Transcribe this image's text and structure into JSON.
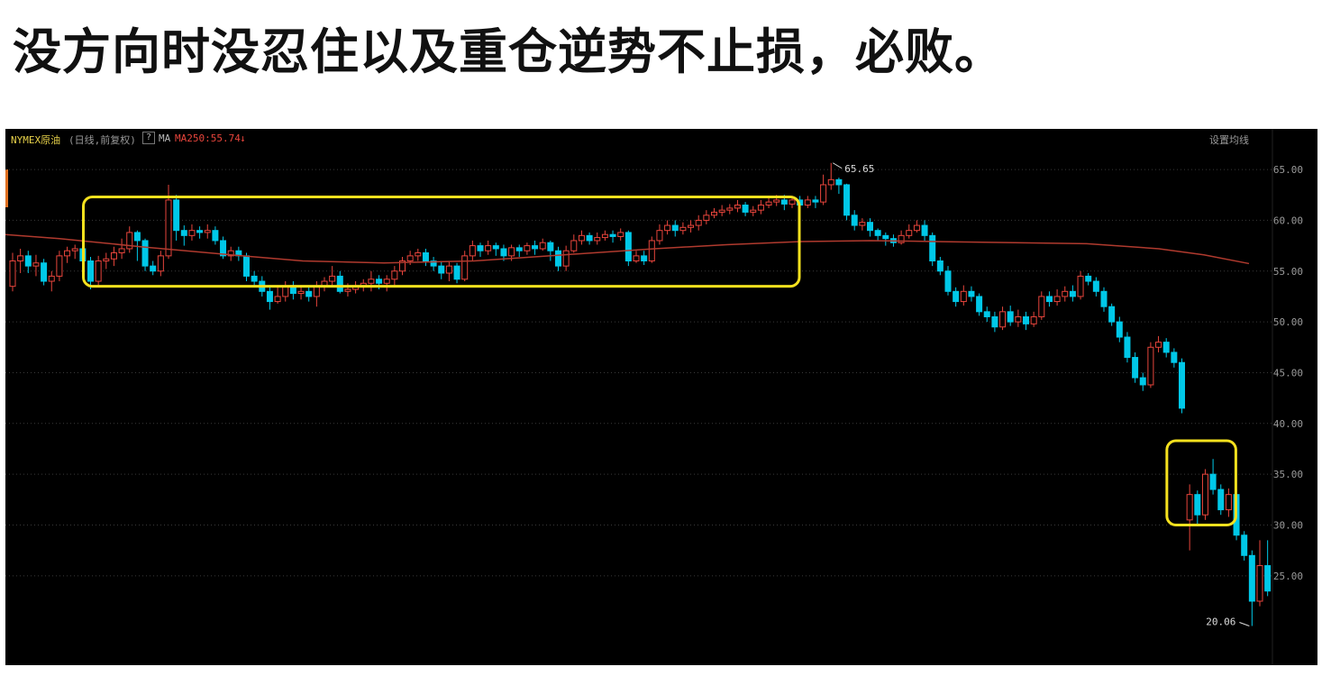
{
  "headline": "没方向时没忍住以及重仓逆势不止损，必败。",
  "chart_header": {
    "symbol": "NYMEX原油",
    "mode": "(日线,前复权)",
    "help": "?",
    "ma_label": "MA",
    "ma250_text": "MA250:55.74",
    "arrow": "↓",
    "set_ma": "设置均线"
  },
  "colors": {
    "background": "#000000",
    "up": "#e8453c",
    "down": "#00c8e8",
    "ma250": "#b03a2e",
    "highlight_box": "#f5e11e",
    "grid": "#3a3a3a",
    "axis_text": "#9a9a9a"
  },
  "chart_data": {
    "type": "candlestick",
    "title": "",
    "xlabel": "",
    "ylabel": "",
    "ylim": [
      16.2,
      69.0
    ],
    "ytick_labels": [
      "65.00",
      "60.00",
      "55.00",
      "50.00",
      "45.00",
      "40.00",
      "35.00",
      "30.00",
      "25.00"
    ],
    "grid": true,
    "max_annotation": "65.65",
    "min_annotation": "20.06",
    "series": [
      {
        "name": "MA250",
        "values": [
          [
            0,
            58.6
          ],
          [
            60,
            58.2
          ],
          [
            150,
            57.4
          ],
          [
            250,
            56.6
          ],
          [
            330,
            56.0
          ],
          [
            420,
            55.8
          ],
          [
            520,
            56.0
          ],
          [
            620,
            56.6
          ],
          [
            720,
            57.2
          ],
          [
            800,
            57.6
          ],
          [
            880,
            57.9
          ],
          [
            960,
            58.0
          ],
          [
            1040,
            57.9
          ],
          [
            1120,
            57.8
          ],
          [
            1200,
            57.7
          ],
          [
            1280,
            57.2
          ],
          [
            1330,
            56.6
          ],
          [
            1380,
            55.74
          ]
        ]
      }
    ],
    "candles": [
      [
        53.5,
        56.0,
        56.8,
        53.0
      ],
      [
        56.0,
        56.5,
        57.2,
        54.8
      ],
      [
        56.5,
        55.5,
        57.0,
        54.8
      ],
      [
        55.5,
        55.8,
        56.6,
        54.5
      ],
      [
        55.8,
        54.0,
        56.2,
        53.6
      ],
      [
        54.0,
        54.5,
        55.0,
        53.0
      ],
      [
        54.5,
        56.5,
        57.0,
        54.0
      ],
      [
        56.5,
        57.0,
        57.4,
        55.8
      ],
      [
        57.0,
        57.2,
        57.6,
        56.2
      ],
      [
        57.2,
        56.0,
        57.6,
        55.2
      ],
      [
        56.0,
        54.0,
        56.4,
        53.2
      ],
      [
        54.0,
        56.0,
        56.5,
        53.5
      ],
      [
        56.0,
        56.2,
        56.8,
        55.2
      ],
      [
        56.2,
        56.8,
        57.4,
        55.5
      ],
      [
        56.8,
        57.2,
        58.2,
        56.2
      ],
      [
        57.2,
        58.8,
        59.4,
        56.8
      ],
      [
        58.8,
        58.0,
        59.0,
        56.0
      ],
      [
        58.0,
        55.5,
        58.2,
        55.0
      ],
      [
        55.5,
        55.0,
        56.0,
        54.6
      ],
      [
        55.0,
        56.5,
        57.0,
        54.5
      ],
      [
        56.5,
        62.0,
        63.5,
        56.2
      ],
      [
        62.0,
        59.0,
        62.5,
        58.0
      ],
      [
        59.0,
        58.5,
        59.5,
        57.5
      ],
      [
        58.5,
        59.0,
        59.6,
        58.0
      ],
      [
        59.0,
        58.8,
        59.4,
        58.2
      ],
      [
        58.8,
        59.0,
        59.6,
        58.2
      ],
      [
        59.0,
        58.0,
        59.4,
        57.6
      ],
      [
        58.0,
        56.5,
        58.4,
        56.2
      ],
      [
        56.5,
        57.0,
        57.4,
        56.0
      ],
      [
        57.0,
        56.5,
        57.4,
        56.0
      ],
      [
        56.5,
        54.5,
        56.8,
        54.0
      ],
      [
        54.5,
        54.0,
        55.0,
        53.5
      ],
      [
        54.0,
        53.0,
        54.5,
        52.5
      ],
      [
        53.0,
        52.0,
        53.5,
        51.2
      ],
      [
        52.0,
        52.5,
        53.5,
        51.8
      ],
      [
        52.5,
        53.5,
        54.0,
        52.0
      ],
      [
        53.5,
        52.8,
        54.0,
        52.2
      ],
      [
        52.8,
        53.0,
        53.6,
        52.2
      ],
      [
        53.0,
        52.5,
        53.6,
        52.0
      ],
      [
        52.5,
        53.5,
        54.0,
        51.5
      ],
      [
        53.5,
        54.0,
        54.4,
        53.0
      ],
      [
        54.0,
        54.5,
        55.5,
        53.5
      ],
      [
        54.5,
        53.0,
        55.0,
        52.8
      ],
      [
        53.0,
        53.2,
        53.8,
        52.5
      ],
      [
        53.2,
        53.5,
        54.0,
        52.8
      ],
      [
        53.5,
        53.8,
        54.2,
        53.0
      ],
      [
        53.8,
        54.2,
        55.0,
        53.0
      ],
      [
        54.2,
        53.8,
        54.6,
        53.2
      ],
      [
        53.8,
        54.2,
        54.6,
        53.0
      ],
      [
        54.2,
        55.0,
        55.5,
        53.5
      ],
      [
        55.0,
        56.0,
        56.4,
        54.6
      ],
      [
        56.0,
        56.5,
        57.0,
        55.6
      ],
      [
        56.5,
        56.8,
        57.2,
        56.0
      ],
      [
        56.8,
        56.0,
        57.2,
        55.5
      ],
      [
        56.0,
        55.5,
        56.4,
        55.0
      ],
      [
        55.5,
        54.8,
        56.0,
        54.2
      ],
      [
        54.8,
        55.5,
        56.0,
        54.0
      ],
      [
        55.5,
        54.2,
        55.8,
        53.8
      ],
      [
        54.2,
        56.5,
        57.0,
        54.0
      ],
      [
        56.5,
        57.5,
        58.0,
        56.0
      ],
      [
        57.5,
        57.0,
        57.8,
        56.4
      ],
      [
        57.0,
        57.5,
        58.0,
        56.6
      ],
      [
        57.5,
        57.2,
        57.8,
        56.5
      ],
      [
        57.2,
        56.5,
        57.6,
        56.0
      ],
      [
        56.5,
        57.3,
        57.6,
        56.0
      ],
      [
        57.3,
        57.0,
        57.6,
        56.4
      ],
      [
        57.0,
        57.5,
        57.8,
        56.6
      ],
      [
        57.5,
        57.2,
        58.0,
        56.6
      ],
      [
        57.2,
        57.8,
        58.2,
        57.0
      ],
      [
        57.8,
        57.0,
        58.0,
        56.0
      ],
      [
        57.0,
        55.5,
        57.4,
        55.0
      ],
      [
        55.5,
        57.0,
        57.5,
        55.0
      ],
      [
        57.0,
        58.0,
        58.6,
        56.8
      ],
      [
        58.0,
        58.5,
        59.0,
        57.6
      ],
      [
        58.5,
        58.0,
        58.8,
        57.6
      ],
      [
        58.0,
        58.3,
        58.8,
        57.6
      ],
      [
        58.3,
        58.6,
        59.0,
        58.0
      ],
      [
        58.6,
        58.4,
        59.0,
        57.8
      ],
      [
        58.4,
        58.8,
        59.2,
        58.0
      ],
      [
        58.8,
        56.0,
        59.0,
        55.5
      ],
      [
        56.0,
        56.5,
        57.0,
        55.8
      ],
      [
        56.5,
        56.0,
        57.0,
        55.6
      ],
      [
        56.0,
        58.0,
        58.4,
        55.8
      ],
      [
        58.0,
        59.0,
        59.6,
        57.6
      ],
      [
        59.0,
        59.5,
        60.0,
        58.6
      ],
      [
        59.5,
        59.0,
        60.0,
        58.4
      ],
      [
        59.0,
        59.3,
        59.8,
        58.6
      ],
      [
        59.3,
        59.5,
        60.0,
        58.8
      ],
      [
        59.5,
        60.0,
        60.5,
        59.0
      ],
      [
        60.0,
        60.5,
        61.0,
        59.6
      ],
      [
        60.5,
        60.8,
        61.2,
        60.2
      ],
      [
        60.8,
        61.0,
        61.5,
        60.4
      ],
      [
        61.0,
        61.2,
        61.6,
        60.6
      ],
      [
        61.2,
        61.5,
        62.0,
        60.8
      ],
      [
        61.5,
        60.8,
        61.8,
        60.4
      ],
      [
        60.8,
        61.0,
        61.4,
        60.4
      ],
      [
        61.0,
        61.5,
        62.0,
        60.6
      ],
      [
        61.5,
        61.8,
        62.2,
        61.2
      ],
      [
        61.8,
        62.0,
        62.5,
        61.4
      ],
      [
        62.0,
        61.6,
        62.5,
        61.0
      ],
      [
        61.6,
        62.0,
        62.4,
        61.2
      ],
      [
        62.0,
        61.5,
        62.4,
        61.0
      ],
      [
        61.5,
        62.0,
        62.4,
        61.2
      ],
      [
        62.0,
        61.8,
        62.4,
        61.2
      ],
      [
        61.8,
        63.5,
        64.5,
        61.5
      ],
      [
        63.5,
        64.0,
        65.65,
        63.0
      ],
      [
        64.0,
        63.5,
        64.2,
        62.6
      ],
      [
        63.5,
        60.5,
        63.6,
        60.0
      ],
      [
        60.5,
        59.5,
        61.0,
        59.0
      ],
      [
        59.5,
        59.8,
        60.2,
        59.0
      ],
      [
        59.8,
        59.0,
        60.2,
        58.4
      ],
      [
        59.0,
        58.5,
        59.2,
        58.0
      ],
      [
        58.5,
        58.2,
        58.8,
        57.5
      ],
      [
        58.2,
        57.8,
        58.6,
        57.4
      ],
      [
        57.8,
        58.5,
        59.0,
        57.6
      ],
      [
        58.5,
        59.0,
        59.6,
        58.2
      ],
      [
        59.0,
        59.5,
        60.0,
        58.8
      ],
      [
        59.5,
        58.5,
        60.0,
        58.0
      ],
      [
        58.5,
        56.0,
        58.8,
        55.5
      ],
      [
        56.0,
        55.0,
        56.4,
        54.6
      ],
      [
        55.0,
        53.0,
        55.5,
        52.6
      ],
      [
        53.0,
        52.0,
        53.4,
        51.5
      ],
      [
        52.0,
        53.0,
        53.6,
        51.6
      ],
      [
        53.0,
        52.5,
        53.5,
        52.0
      ],
      [
        52.5,
        51.0,
        52.8,
        50.6
      ],
      [
        51.0,
        50.5,
        51.5,
        50.0
      ],
      [
        50.5,
        49.5,
        51.0,
        49.0
      ],
      [
        49.5,
        51.0,
        51.5,
        49.2
      ],
      [
        51.0,
        50.0,
        51.6,
        49.6
      ],
      [
        50.0,
        50.5,
        51.2,
        49.5
      ],
      [
        50.5,
        49.8,
        51.0,
        49.2
      ],
      [
        49.8,
        50.5,
        51.0,
        49.5
      ],
      [
        50.5,
        52.5,
        53.0,
        50.2
      ],
      [
        52.5,
        52.0,
        53.0,
        51.5
      ],
      [
        52.0,
        52.5,
        53.2,
        51.6
      ],
      [
        52.5,
        53.0,
        53.5,
        52.0
      ],
      [
        53.0,
        52.5,
        53.6,
        52.0
      ],
      [
        52.5,
        54.5,
        55.0,
        52.2
      ],
      [
        54.5,
        54.0,
        54.8,
        53.6
      ],
      [
        54.0,
        53.0,
        54.4,
        52.5
      ],
      [
        53.0,
        51.5,
        53.4,
        51.0
      ],
      [
        51.5,
        50.0,
        51.8,
        49.6
      ],
      [
        50.0,
        48.5,
        50.5,
        48.0
      ],
      [
        48.5,
        46.5,
        49.0,
        46.0
      ],
      [
        46.5,
        44.5,
        47.0,
        44.0
      ],
      [
        44.5,
        43.8,
        45.0,
        43.2
      ],
      [
        43.8,
        47.5,
        48.0,
        43.5
      ],
      [
        47.5,
        48.0,
        48.6,
        47.0
      ],
      [
        48.0,
        47.0,
        48.4,
        46.5
      ],
      [
        47.0,
        46.0,
        47.4,
        45.5
      ],
      [
        46.0,
        41.5,
        46.4,
        41.0
      ],
      [
        30.5,
        33.0,
        34.0,
        27.5
      ],
      [
        33.0,
        31.0,
        33.4,
        30.0
      ],
      [
        31.0,
        35.0,
        35.5,
        30.5
      ],
      [
        35.0,
        33.5,
        36.5,
        33.0
      ],
      [
        33.5,
        31.5,
        34.0,
        31.0
      ],
      [
        31.5,
        33.0,
        33.6,
        30.8
      ],
      [
        33.0,
        29.0,
        33.4,
        28.5
      ],
      [
        29.0,
        27.0,
        29.4,
        26.5
      ],
      [
        27.0,
        22.5,
        27.5,
        20.06
      ],
      [
        22.5,
        26.0,
        28.5,
        22.0
      ],
      [
        26.0,
        23.5,
        28.5,
        23.0
      ]
    ],
    "highlight_boxes": [
      {
        "from_index": 10,
        "to_index": 100,
        "y_low": 53.5,
        "y_high": 62.3
      },
      {
        "from_index": 149,
        "to_index": 156,
        "y_low": 30.0,
        "y_high": 38.3
      }
    ]
  }
}
